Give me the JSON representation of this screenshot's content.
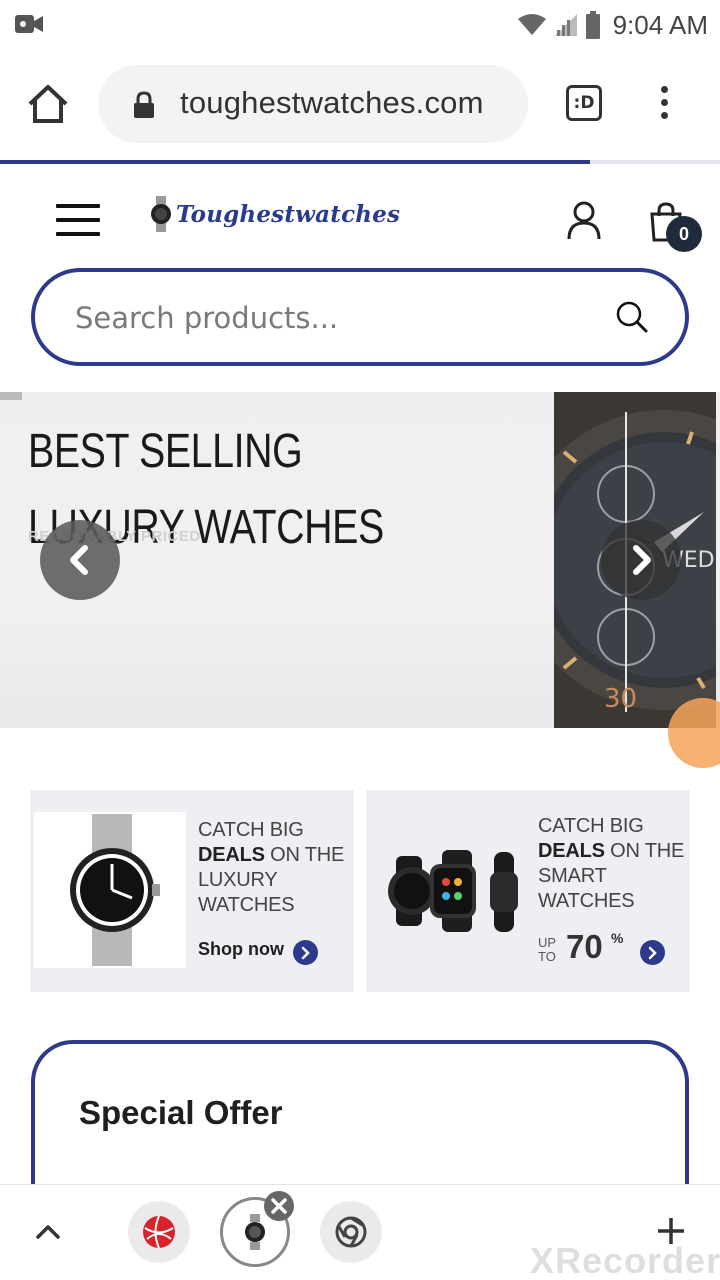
{
  "status_bar": {
    "time": "9:04 AM",
    "icons": [
      "screen-record-icon",
      "wifi-icon",
      "signal-icon",
      "battery-icon"
    ]
  },
  "browser": {
    "url": "toughestwatches.com",
    "tab_switcher_label": ":D",
    "page_load_progress": 0.82,
    "icons": [
      "home-icon",
      "lock-icon",
      "menu-kebab-icon"
    ]
  },
  "site_header": {
    "logo_text": "Toughestwatches",
    "cart_count": "0",
    "icons": [
      "hamburger-menu-icon",
      "user-account-icon",
      "shopping-bag-icon"
    ]
  },
  "search": {
    "placeholder": "Search products..."
  },
  "hero": {
    "title_line1": "BEST SELLING",
    "title_line2": "LUXURY WATCHES",
    "subtitle": "REASONABLY PRICED"
  },
  "deals": [
    {
      "line1": "CATCH BIG",
      "bold": "DEALS",
      "line2_rest": " ON THE",
      "line3": "LUXURY",
      "line4": "WATCHES",
      "cta": "Shop now"
    },
    {
      "line1": "CATCH BIG",
      "bold": "DEALS",
      "line2_rest": " ON THE",
      "line3": "SMART",
      "line4": "WATCHES",
      "upto_1": "UP",
      "upto_2": "TO",
      "percent": "70",
      "percent_sign": "%"
    }
  ],
  "special_offer": {
    "title": "Special Offer"
  },
  "colors": {
    "brand_blue": "#2d3a8c",
    "card_bg": "#eeeff3",
    "badge_dark": "#1f2a3a"
  },
  "watermark": "XRecorder"
}
